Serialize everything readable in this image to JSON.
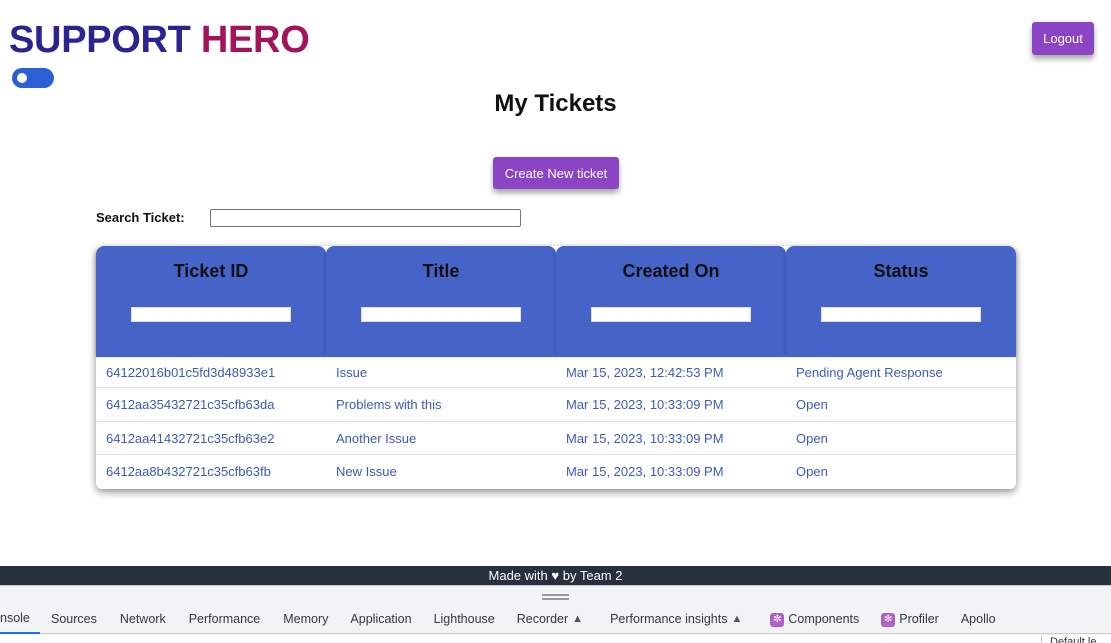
{
  "brand": {
    "part1": "SUPPORT",
    "part2": "HERO"
  },
  "header": {
    "logout_label": "Logout"
  },
  "page": {
    "title": "My Tickets",
    "create_label": "Create New ticket"
  },
  "search": {
    "label": "Search Ticket:",
    "value": ""
  },
  "table": {
    "columns": [
      "Ticket ID",
      "Title",
      "Created On",
      "Status"
    ],
    "rows": [
      [
        "64122016b01c5fd3d48933e1",
        "Issue",
        "Mar 15, 2023, 12:42:53 PM",
        "Pending Agent Response"
      ],
      [
        "6412aa35432721c35cfb63da",
        "Problems with this",
        "Mar 15, 2023, 10:33:09 PM",
        "Open"
      ],
      [
        "6412aa41432721c35cfb63e2",
        "Another Issue",
        "Mar 15, 2023, 10:33:09 PM",
        "Open"
      ],
      [
        "6412aa8b432721c35cfb63fb",
        "New Issue",
        "Mar 15, 2023, 10:33:09 PM",
        "Open"
      ]
    ]
  },
  "footer": {
    "text_before": "Made with",
    "heart_icon": "heart-icon",
    "text_after": "by Team 2"
  },
  "devtools": {
    "tabs": [
      "nsole",
      "Sources",
      "Network",
      "Performance",
      "Memory",
      "Application",
      "Lighthouse",
      "Recorder",
      "Performance insights",
      "Components",
      "Profiler",
      "Apollo"
    ],
    "active_tab": "nsole",
    "right_label": "Default le"
  },
  "colors": {
    "brand_blue": "#2b2390",
    "brand_red": "#a3145a",
    "accent_purple": "#8a44c4",
    "table_header": "#4663c8",
    "link_blue": "#3b5bb8",
    "footer_bg": "#26313d"
  }
}
